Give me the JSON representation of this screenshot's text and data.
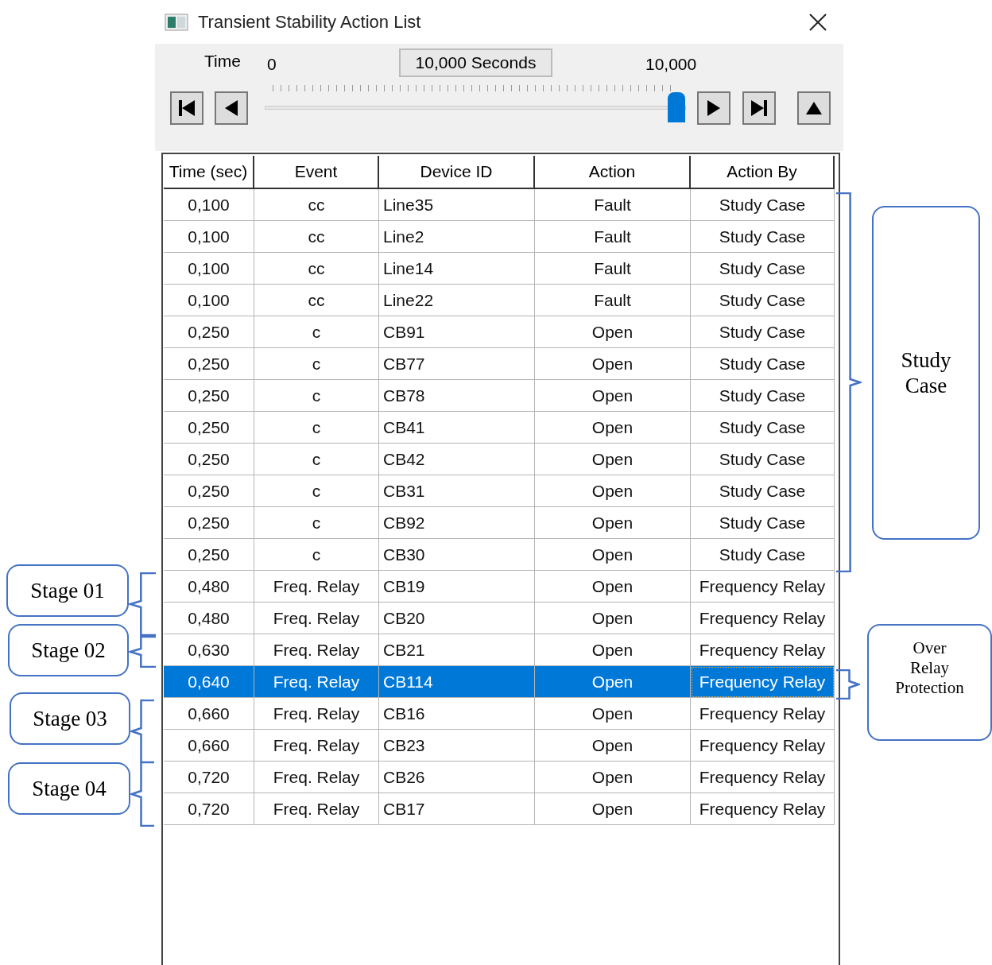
{
  "window": {
    "title": "Transient Stability Action List"
  },
  "toolbar": {
    "time_label": "Time",
    "start": "0",
    "current": "10,000 Seconds",
    "end": "10,000",
    "slider": {
      "level": 1
    }
  },
  "table": {
    "columns": [
      "Time (sec)",
      "Event",
      "Device ID",
      "Action",
      "Action By"
    ],
    "rows": [
      {
        "cells": [
          "0,100",
          "cc",
          "Line35",
          "Fault",
          "Study Case"
        ],
        "selected": false
      },
      {
        "cells": [
          "0,100",
          "cc",
          "Line2",
          "Fault",
          "Study Case"
        ],
        "selected": false
      },
      {
        "cells": [
          "0,100",
          "cc",
          "Line14",
          "Fault",
          "Study Case"
        ],
        "selected": false
      },
      {
        "cells": [
          "0,100",
          "cc",
          "Line22",
          "Fault",
          "Study Case"
        ],
        "selected": false
      },
      {
        "cells": [
          "0,250",
          "c",
          "CB91",
          "Open",
          "Study Case"
        ],
        "selected": false
      },
      {
        "cells": [
          "0,250",
          "c",
          "CB77",
          "Open",
          "Study Case"
        ],
        "selected": false
      },
      {
        "cells": [
          "0,250",
          "c",
          "CB78",
          "Open",
          "Study Case"
        ],
        "selected": false
      },
      {
        "cells": [
          "0,250",
          "c",
          "CB41",
          "Open",
          "Study Case"
        ],
        "selected": false
      },
      {
        "cells": [
          "0,250",
          "c",
          "CB42",
          "Open",
          "Study Case"
        ],
        "selected": false
      },
      {
        "cells": [
          "0,250",
          "c",
          "CB31",
          "Open",
          "Study Case"
        ],
        "selected": false
      },
      {
        "cells": [
          "0,250",
          "c",
          "CB92",
          "Open",
          "Study Case"
        ],
        "selected": false
      },
      {
        "cells": [
          "0,250",
          "c",
          "CB30",
          "Open",
          "Study Case"
        ],
        "selected": false
      },
      {
        "cells": [
          "0,480",
          "Freq. Relay",
          "CB19",
          "Open",
          "Frequency Relay"
        ],
        "selected": false
      },
      {
        "cells": [
          "0,480",
          "Freq. Relay",
          "CB20",
          "Open",
          "Frequency Relay"
        ],
        "selected": false
      },
      {
        "cells": [
          "0,630",
          "Freq. Relay",
          "CB21",
          "Open",
          "Frequency Relay"
        ],
        "selected": false
      },
      {
        "cells": [
          "0,640",
          "Freq. Relay",
          "CB114",
          "Open",
          "Frequency Relay"
        ],
        "selected": true
      },
      {
        "cells": [
          "0,660",
          "Freq. Relay",
          "CB16",
          "Open",
          "Frequency Relay"
        ],
        "selected": false
      },
      {
        "cells": [
          "0,660",
          "Freq. Relay",
          "CB23",
          "Open",
          "Frequency Relay"
        ],
        "selected": false
      },
      {
        "cells": [
          "0,720",
          "Freq. Relay",
          "CB26",
          "Open",
          "Frequency Relay"
        ],
        "selected": false
      },
      {
        "cells": [
          "0,720",
          "Freq. Relay",
          "CB17",
          "Open",
          "Frequency Relay"
        ],
        "selected": false
      }
    ]
  },
  "annotations": [
    {
      "lines": [
        "Stage 01"
      ],
      "kind": "left"
    },
    {
      "lines": [
        "Stage 02"
      ],
      "kind": "left"
    },
    {
      "lines": [
        "Stage 03"
      ],
      "kind": "left"
    },
    {
      "lines": [
        "Stage 04"
      ],
      "kind": "left"
    },
    {
      "lines": [
        "Study",
        "Case"
      ],
      "kind": "right"
    },
    {
      "lines": [
        "Over",
        "Relay",
        "Protection"
      ],
      "kind": "right"
    }
  ]
}
